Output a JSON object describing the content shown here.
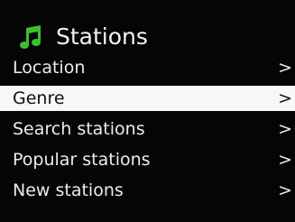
{
  "header": {
    "title": "Stations",
    "icon": "music-note-icon",
    "icon_color": "#3cbf2e"
  },
  "menu": {
    "items": [
      {
        "label": "Location",
        "chevron": ">",
        "selected": false
      },
      {
        "label": "Genre",
        "chevron": ">",
        "selected": true
      },
      {
        "label": "Search stations",
        "chevron": ">",
        "selected": false
      },
      {
        "label": "Popular stations",
        "chevron": ">",
        "selected": false
      },
      {
        "label": "New stations",
        "chevron": ">",
        "selected": false
      }
    ]
  },
  "colors": {
    "background": "#050505",
    "text": "#ececec",
    "selected_background": "#f7f7f7",
    "selected_text": "#111111"
  }
}
